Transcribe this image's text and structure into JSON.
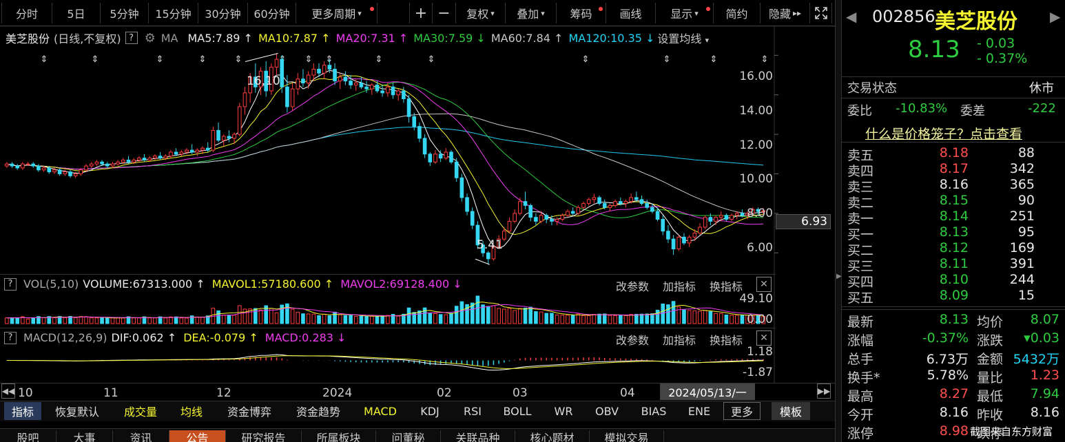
{
  "toolbar": {
    "fenshi": "分时",
    "day5": "5日",
    "m5": "5分钟",
    "m15": "15分钟",
    "m30": "30分钟",
    "m60": "60分钟",
    "more": "更多周期",
    "plus": "+",
    "minus": "−",
    "fuquan": "复权",
    "diejia": "叠加",
    "chouma": "筹码",
    "huaxian": "画线",
    "xianshi": "显示",
    "jianyue": "简约",
    "yincang": "隐藏",
    "fs_icon": "fullscreen-icon"
  },
  "ma_header": {
    "name": "美芝股份",
    "mode": "(日线,不复权)",
    "q": "?",
    "gear": "gear-icon",
    "ma": "MA",
    "ma5": "MA5:7.89",
    "ma10": "MA10:7.87",
    "ma20": "MA20:7.31",
    "ma30": "MA30:7.59",
    "ma60": "MA60:7.84",
    "ma120": "MA120:10.35",
    "setting": "设置均线"
  },
  "price_axis": {
    "labels": [
      "16.00",
      "14.00",
      "12.00",
      "10.00",
      "8.00",
      "6.00"
    ],
    "current": "6.93"
  },
  "annotations": {
    "high": "16.10",
    "low": "5.41"
  },
  "vol_panel": {
    "q": "?",
    "title": "VOL(5,10)",
    "volume": "VOLUME:67313.000",
    "mavol1": "MAVOL1:57180.600",
    "mavol2": "MAVOL2:69128.400",
    "gaicanshu": "改参数",
    "jiazhibiao": "加指标",
    "huanzhibiao": "换指标",
    "axis_top": "49.10",
    "axis_bottom": "0.00"
  },
  "macd_panel": {
    "q": "?",
    "title": "MACD(12,26,9)",
    "dif": "DIF:0.062",
    "dea": "DEA:-0.079",
    "macd": "MACD:0.283",
    "gaicanshu": "改参数",
    "jiazhibiao": "加指标",
    "huanzhibiao": "换指标",
    "axis_top": "1.18",
    "axis_bottom": "-1.87"
  },
  "time_axis": {
    "labels": [
      "10",
      "11",
      "12",
      "2024",
      "02",
      "03",
      "04"
    ],
    "cursor_date": "2024/05/13/一"
  },
  "bottom_bar": [
    "指标",
    "恢复默认",
    "成交量",
    "均线",
    "资金博弈",
    "资金趋势",
    "MACD",
    "KDJ",
    "RSI",
    "BOLL",
    "WR",
    "OBV",
    "BIAS",
    "ENE",
    "更多",
    "模板"
  ],
  "bottom_tabs": [
    "股吧",
    "大事",
    "资讯",
    "公告",
    "研究报告",
    "所属板块",
    "问董秘",
    "关联品种",
    "核心题材",
    "模拟交易"
  ],
  "stock": {
    "code": "002856",
    "name": "美芝股份",
    "price": "8.13",
    "change": "- 0.03",
    "change_pct": "- 0.37%",
    "status_label": "交易状态",
    "status": "休市",
    "weibi_label": "委比",
    "weibi": "-10.83%",
    "weicha_label": "委差",
    "weicha": "-222",
    "cage_link": "什么是价格笼子？点击查看"
  },
  "order_book": {
    "sells": [
      {
        "label": "卖五",
        "price": "8.18",
        "vol": "88"
      },
      {
        "label": "卖四",
        "price": "8.17",
        "vol": "342"
      },
      {
        "label": "卖三",
        "price": "8.16",
        "vol": "365"
      },
      {
        "label": "卖二",
        "price": "8.15",
        "vol": "90"
      },
      {
        "label": "卖一",
        "price": "8.14",
        "vol": "251"
      }
    ],
    "buys": [
      {
        "label": "买一",
        "price": "8.13",
        "vol": "95"
      },
      {
        "label": "买二",
        "price": "8.12",
        "vol": "169"
      },
      {
        "label": "买三",
        "price": "8.11",
        "vol": "391"
      },
      {
        "label": "买四",
        "price": "8.10",
        "vol": "244"
      },
      {
        "label": "买五",
        "price": "8.09",
        "vol": "15"
      }
    ]
  },
  "quote": [
    {
      "l1": "最新",
      "v1": "8.13",
      "l2": "均价",
      "v2": "8.07"
    },
    {
      "l1": "涨幅",
      "v1": "-0.37%",
      "l2": "涨跌",
      "v2": "▾0.03"
    },
    {
      "l1": "总手",
      "v1": "6.73万",
      "l2": "金额",
      "v2": "5432万"
    },
    {
      "l1": "换手*",
      "v1": "5.78%",
      "l2": "量比",
      "v2": "1.23"
    },
    {
      "l1": "最高",
      "v1": "8.27",
      "l2": "最低",
      "v2": "7.94"
    },
    {
      "l1": "今开",
      "v1": "8.16",
      "l2": "昨收",
      "v2": "8.16"
    },
    {
      "l1": "涨停",
      "v1": "8.98",
      "l2": "跌停",
      "v2": ""
    }
  ],
  "watermark": "截图来自东方财富",
  "chart_data": {
    "type": "candlestick",
    "price_ylim": [
      5.0,
      16.5
    ],
    "price_ticks": [
      16,
      14,
      12,
      10,
      8,
      6
    ],
    "high_marker": 16.1,
    "low_marker": 5.41,
    "last_price_label": 6.93,
    "ma_values": {
      "MA5": 7.89,
      "MA10": 7.87,
      "MA20": 7.31,
      "MA30": 7.59,
      "MA60": 7.84,
      "MA120": 10.35
    },
    "vol_ylim": [
      0,
      49.1
    ],
    "macd_ylim": [
      -1.87,
      1.18
    ],
    "colors": {
      "up": "#ff3c3c",
      "down": "#35d6f2",
      "ma5": "#ffffff",
      "ma10": "#f5f52f",
      "ma20": "#f03cf0",
      "ma30": "#2ecc40",
      "ma60": "#c8c8c8",
      "ma120": "#21c8f0",
      "dif": "#ffffff",
      "dea": "#f5f52f"
    },
    "candles": [
      [
        10.4,
        10.6,
        10.3,
        10.5
      ],
      [
        10.5,
        10.6,
        10.3,
        10.4
      ],
      [
        10.4,
        10.5,
        10.2,
        10.3
      ],
      [
        10.3,
        10.6,
        10.2,
        10.5
      ],
      [
        10.5,
        10.6,
        10.4,
        10.5
      ],
      [
        10.5,
        10.6,
        10.3,
        10.4
      ],
      [
        10.4,
        10.5,
        10.1,
        10.2
      ],
      [
        10.2,
        10.4,
        10.1,
        10.3
      ],
      [
        10.3,
        10.4,
        10.0,
        10.1
      ],
      [
        10.1,
        10.3,
        10.0,
        10.2
      ],
      [
        10.2,
        10.3,
        9.9,
        10.0
      ],
      [
        10.0,
        10.2,
        9.9,
        10.1
      ],
      [
        10.1,
        10.2,
        9.8,
        9.9
      ],
      [
        9.9,
        10.1,
        9.8,
        10.0
      ],
      [
        10.0,
        10.3,
        9.9,
        10.2
      ],
      [
        10.2,
        10.5,
        10.1,
        10.4
      ],
      [
        10.4,
        10.6,
        10.3,
        10.5
      ],
      [
        10.5,
        10.7,
        10.4,
        10.6
      ],
      [
        10.6,
        10.7,
        10.4,
        10.5
      ],
      [
        10.5,
        10.6,
        10.3,
        10.4
      ],
      [
        10.4,
        10.6,
        10.3,
        10.5
      ],
      [
        10.5,
        10.7,
        10.4,
        10.6
      ],
      [
        10.6,
        10.8,
        10.5,
        10.7
      ],
      [
        10.7,
        10.9,
        10.5,
        10.6
      ],
      [
        10.6,
        10.8,
        10.5,
        10.7
      ],
      [
        10.7,
        10.9,
        10.6,
        10.8
      ],
      [
        10.8,
        11.0,
        10.6,
        10.7
      ],
      [
        10.7,
        10.9,
        10.6,
        10.8
      ],
      [
        10.8,
        11.0,
        10.7,
        10.9
      ],
      [
        10.9,
        11.1,
        10.7,
        10.8
      ],
      [
        10.8,
        11.0,
        10.7,
        10.9
      ],
      [
        10.9,
        11.2,
        10.8,
        11.1
      ],
      [
        11.1,
        11.3,
        10.9,
        11.0
      ],
      [
        11.0,
        11.2,
        10.9,
        11.1
      ],
      [
        11.1,
        11.3,
        11.0,
        11.2
      ],
      [
        11.2,
        11.5,
        11.0,
        11.1
      ],
      [
        11.1,
        11.3,
        10.9,
        11.2
      ],
      [
        11.2,
        11.4,
        11.0,
        11.3
      ],
      [
        11.3,
        11.6,
        11.1,
        11.2
      ],
      [
        11.2,
        12.4,
        11.1,
        12.2
      ],
      [
        12.2,
        12.6,
        11.6,
        11.7
      ],
      [
        11.7,
        12.0,
        11.4,
        11.9
      ],
      [
        11.9,
        12.2,
        11.6,
        11.8
      ],
      [
        11.8,
        12.1,
        11.5,
        12.0
      ],
      [
        12.0,
        13.6,
        11.9,
        13.4
      ],
      [
        13.4,
        14.4,
        13.0,
        14.1
      ],
      [
        14.1,
        15.1,
        13.6,
        14.9
      ],
      [
        14.9,
        15.6,
        14.1,
        14.4
      ],
      [
        14.4,
        15.4,
        14.0,
        15.2
      ],
      [
        15.2,
        15.7,
        13.9,
        14.2
      ],
      [
        14.2,
        15.6,
        14.0,
        15.4
      ],
      [
        15.4,
        16.1,
        15.0,
        15.8
      ],
      [
        15.8,
        16.0,
        14.1,
        14.4
      ],
      [
        14.4,
        15.0,
        13.1,
        13.4
      ],
      [
        13.4,
        14.6,
        13.2,
        14.3
      ],
      [
        14.3,
        15.1,
        14.0,
        14.8
      ],
      [
        14.8,
        15.3,
        14.4,
        14.6
      ],
      [
        14.6,
        15.2,
        14.3,
        15.0
      ],
      [
        15.0,
        15.6,
        14.7,
        15.3
      ],
      [
        15.3,
        15.6,
        14.9,
        15.1
      ],
      [
        15.1,
        15.7,
        14.8,
        15.5
      ],
      [
        15.5,
        15.8,
        15.1,
        15.3
      ],
      [
        15.3,
        15.6,
        14.5,
        14.7
      ],
      [
        14.7,
        15.1,
        14.3,
        14.9
      ],
      [
        14.9,
        15.2,
        14.5,
        14.7
      ],
      [
        14.7,
        15.0,
        14.3,
        14.5
      ],
      [
        14.5,
        14.8,
        14.2,
        14.6
      ],
      [
        14.6,
        14.9,
        14.3,
        14.4
      ],
      [
        14.4,
        14.7,
        14.1,
        14.3
      ],
      [
        14.3,
        14.6,
        14.0,
        14.5
      ],
      [
        14.5,
        14.7,
        14.1,
        14.2
      ],
      [
        14.2,
        14.5,
        13.9,
        14.1
      ],
      [
        14.1,
        14.6,
        13.9,
        14.4
      ],
      [
        14.4,
        14.6,
        13.8,
        14.0
      ],
      [
        14.0,
        14.3,
        13.7,
        14.2
      ],
      [
        14.2,
        14.4,
        13.6,
        13.8
      ],
      [
        13.8,
        14.0,
        12.6,
        12.9
      ],
      [
        12.9,
        13.1,
        12.2,
        12.4
      ],
      [
        12.4,
        12.6,
        11.6,
        11.8
      ],
      [
        11.8,
        12.0,
        10.8,
        11.0
      ],
      [
        11.0,
        11.1,
        10.4,
        10.6
      ],
      [
        10.6,
        11.2,
        10.5,
        11.0
      ],
      [
        11.0,
        11.2,
        10.6,
        10.8
      ],
      [
        10.8,
        11.3,
        10.7,
        11.1
      ],
      [
        11.1,
        11.2,
        10.5,
        10.6
      ],
      [
        10.6,
        10.8,
        9.6,
        9.8
      ],
      [
        9.8,
        10.0,
        8.6,
        8.8
      ],
      [
        8.8,
        9.0,
        7.9,
        8.1
      ],
      [
        8.1,
        8.3,
        7.2,
        7.4
      ],
      [
        7.4,
        7.6,
        6.2,
        6.4
      ],
      [
        6.4,
        6.6,
        5.8,
        6.0
      ],
      [
        6.0,
        6.1,
        5.41,
        5.7
      ],
      [
        5.7,
        6.4,
        5.6,
        6.3
      ],
      [
        6.3,
        6.9,
        6.2,
        6.7
      ],
      [
        6.7,
        7.3,
        6.6,
        7.1
      ],
      [
        7.1,
        7.8,
        7.0,
        7.6
      ],
      [
        7.6,
        8.2,
        7.5,
        8.0
      ],
      [
        8.0,
        8.8,
        7.9,
        8.6
      ],
      [
        8.6,
        9.1,
        8.2,
        8.4
      ],
      [
        8.4,
        8.5,
        7.6,
        7.8
      ],
      [
        7.8,
        8.0,
        7.4,
        7.6
      ],
      [
        7.6,
        8.1,
        7.5,
        7.9
      ],
      [
        7.9,
        8.0,
        7.5,
        7.7
      ],
      [
        7.7,
        7.9,
        7.4,
        7.6
      ],
      [
        7.6,
        7.8,
        7.4,
        7.7
      ],
      [
        7.7,
        8.0,
        7.6,
        7.9
      ],
      [
        7.9,
        8.2,
        7.8,
        8.1
      ],
      [
        8.1,
        8.3,
        7.9,
        8.0
      ],
      [
        8.0,
        8.4,
        7.9,
        8.3
      ],
      [
        8.3,
        8.6,
        8.2,
        8.5
      ],
      [
        8.5,
        8.8,
        8.4,
        8.7
      ],
      [
        8.7,
        9.0,
        8.5,
        8.8
      ],
      [
        8.8,
        8.9,
        8.4,
        8.5
      ],
      [
        8.5,
        8.7,
        8.2,
        8.3
      ],
      [
        8.3,
        8.5,
        8.1,
        8.4
      ],
      [
        8.4,
        8.7,
        8.3,
        8.6
      ],
      [
        8.6,
        8.8,
        8.4,
        8.5
      ],
      [
        8.5,
        8.7,
        8.3,
        8.6
      ],
      [
        8.6,
        9.0,
        8.5,
        8.8
      ],
      [
        8.8,
        9.1,
        8.6,
        8.7
      ],
      [
        8.7,
        8.9,
        8.4,
        8.5
      ],
      [
        8.5,
        8.7,
        8.2,
        8.3
      ],
      [
        8.3,
        8.5,
        8.0,
        8.1
      ],
      [
        8.1,
        8.3,
        7.6,
        7.7
      ],
      [
        7.7,
        7.9,
        6.9,
        7.1
      ],
      [
        7.1,
        7.4,
        6.5,
        6.7
      ],
      [
        6.7,
        6.9,
        5.9,
        6.2
      ],
      [
        6.2,
        6.9,
        6.1,
        6.8
      ],
      [
        6.8,
        7.0,
        6.4,
        6.5
      ],
      [
        6.5,
        6.9,
        6.3,
        6.8
      ],
      [
        6.8,
        7.2,
        6.6,
        7.0
      ],
      [
        7.0,
        7.5,
        6.9,
        7.3
      ],
      [
        7.3,
        7.9,
        7.2,
        7.8
      ],
      [
        7.8,
        8.0,
        7.4,
        7.6
      ],
      [
        7.6,
        7.9,
        7.4,
        7.8
      ],
      [
        7.8,
        8.1,
        7.6,
        7.9
      ],
      [
        7.9,
        8.0,
        7.6,
        7.7
      ],
      [
        7.7,
        8.0,
        7.6,
        7.9
      ],
      [
        7.9,
        8.1,
        7.7,
        8.0
      ],
      [
        8.0,
        8.2,
        7.8,
        7.9
      ],
      [
        7.9,
        8.1,
        7.7,
        8.0
      ],
      [
        8.0,
        8.3,
        7.9,
        8.2
      ],
      [
        8.2,
        8.3,
        7.9,
        8.1
      ],
      [
        8.1,
        8.27,
        7.94,
        8.13
      ]
    ]
  }
}
